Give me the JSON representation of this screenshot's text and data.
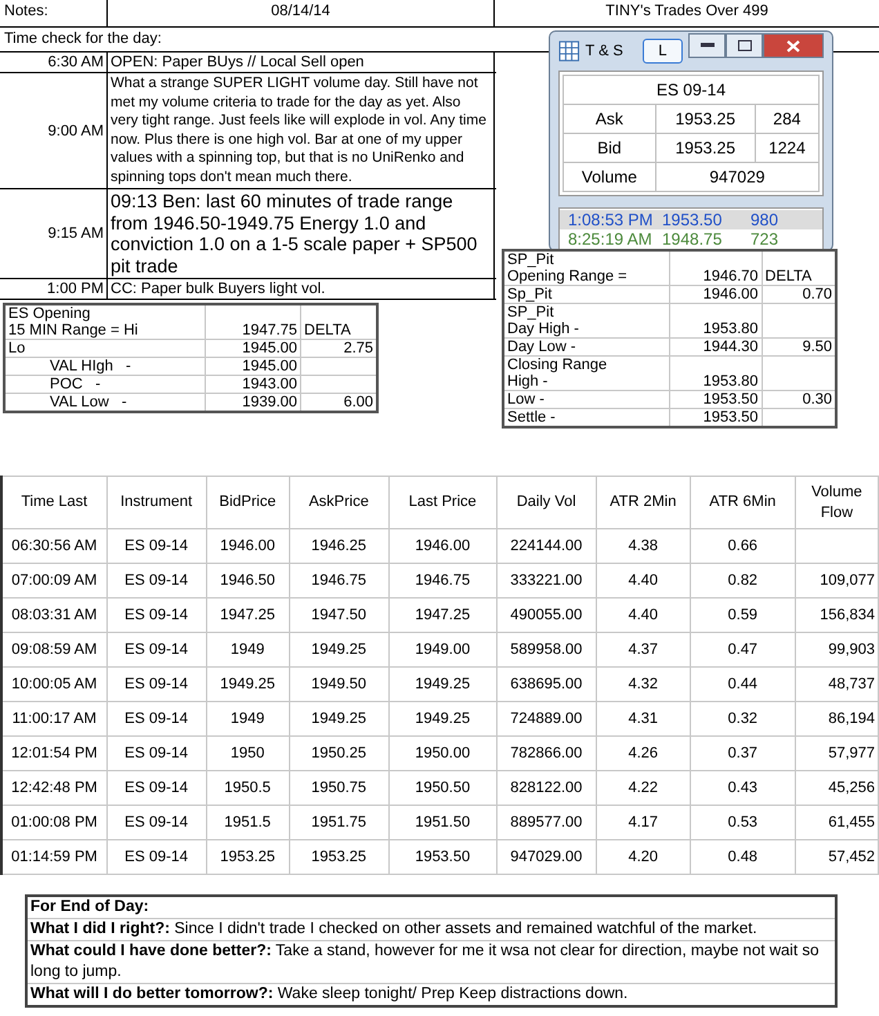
{
  "header": {
    "label": "Notes:",
    "date": "08/14/14",
    "title": "TINY's Trades Over 499"
  },
  "time_check": {
    "label": "Time check for the day:",
    "entries": [
      {
        "time": "6:30 AM",
        "note": "OPEN: Paper BUys // Local Sell open",
        "kind": "normal"
      },
      {
        "time": "9:00 AM",
        "note": "What a strange SUPER LIGHT volume day.  Still have not met my volume criteria to trade for the day as yet.  Also very tight range.  Just feels like will explode in vol. Any time now.  Plus there is one high vol. Bar at one of my upper values with a spinning top, but that is no UniRenko and spinning tops don't mean much there.",
        "kind": "small"
      },
      {
        "time": "9:15 AM",
        "note": "09:13 Ben: last 60 minutes of trade range from 1946.50-1949.75 Energy 1.0 and conviction 1.0 on a 1-5 scale paper + SP500 pit trade",
        "kind": "large"
      },
      {
        "time": "1:00 PM",
        "note": "CC: Paper bulk Buyers light vol.",
        "kind": "normal"
      }
    ]
  },
  "ts_window": {
    "title": "T & S",
    "link_button": "L",
    "symbol": "ES 09-14",
    "quotes": [
      {
        "label": "Ask",
        "price": "1953.25",
        "size": "284"
      },
      {
        "label": "Bid",
        "price": "1953.25",
        "size": "1224"
      }
    ],
    "volume": {
      "label": "Volume",
      "value": "947029"
    },
    "trades": [
      {
        "time": "1:08:53 PM",
        "price": "1953.50",
        "size": "980",
        "selected": true,
        "color": "#2050c8"
      },
      {
        "time": "8:25:19 AM",
        "price": "1948.75",
        "size": "723",
        "selected": false,
        "color": "#4c8a3c"
      }
    ]
  },
  "es_opening": {
    "rows": [
      {
        "label": [
          "ES Opening",
          "15 MIN Range = Hi"
        ],
        "value": "1947.75",
        "delta": "DELTA",
        "indented": false
      },
      {
        "label": [
          "Lo"
        ],
        "value": "1945.00",
        "delta": "2.75",
        "indented": false
      },
      {
        "label": [
          "VAL HIgh   -"
        ],
        "value": "1945.00",
        "delta": "",
        "indented": true
      },
      {
        "label": [
          "POC   -"
        ],
        "value": "1943.00",
        "delta": "",
        "indented": true
      },
      {
        "label": [
          "VAL Low   -"
        ],
        "value": "1939.00",
        "delta": "6.00",
        "indented": true
      }
    ]
  },
  "sp_pit": {
    "rows": [
      {
        "label": [
          "SP_Pit",
          "Opening Range ="
        ],
        "value": "1946.70",
        "delta": "DELTA",
        "indented": false
      },
      {
        "label": [
          "Sp_Pit"
        ],
        "value": "1946.00",
        "delta": "0.70",
        "indented": false
      },
      {
        "label": [
          "SP_Pit",
          "Day High -"
        ],
        "value": "1953.80",
        "delta": "",
        "indented": false
      },
      {
        "label": [
          "Day Low -"
        ],
        "value": "1944.30",
        "delta": "9.50",
        "indented": false
      },
      {
        "label": [
          "Closing Range",
          "High -"
        ],
        "value": "1953.80",
        "delta": "",
        "indented": false
      },
      {
        "label": [
          "Low -"
        ],
        "value": "1953.50",
        "delta": "0.30",
        "indented": false
      },
      {
        "label": [
          "Settle -"
        ],
        "value": "1953.50",
        "delta": "",
        "indented": false
      }
    ]
  },
  "table": {
    "columns": [
      "Time Last",
      "Instrument",
      "BidPrice",
      "AskPrice",
      "Last Price",
      "Daily Vol",
      "ATR 2Min",
      "ATR 6Min",
      "Volume Flow"
    ],
    "rows": [
      [
        "06:30:56 AM",
        "ES 09-14",
        "1946.00",
        "1946.25",
        "1946.00",
        "224144.00",
        "4.38",
        "0.66",
        ""
      ],
      [
        "07:00:09 AM",
        "ES 09-14",
        "1946.50",
        "1946.75",
        "1946.75",
        "333221.00",
        "4.40",
        "0.82",
        "109,077"
      ],
      [
        "08:03:31 AM",
        "ES 09-14",
        "1947.25",
        "1947.50",
        "1947.25",
        "490055.00",
        "4.40",
        "0.59",
        "156,834"
      ],
      [
        "09:08:59 AM",
        "ES 09-14",
        "1949",
        "1949.25",
        "1949.00",
        "589958.00",
        "4.37",
        "0.47",
        "99,903"
      ],
      [
        "10:00:05 AM",
        "ES 09-14",
        "1949.25",
        "1949.50",
        "1949.25",
        "638695.00",
        "4.32",
        "0.44",
        "48,737"
      ],
      [
        "11:00:17 AM",
        "ES 09-14",
        "1949",
        "1949.25",
        "1949.25",
        "724889.00",
        "4.31",
        "0.32",
        "86,194"
      ],
      [
        "12:01:54 PM",
        "ES 09-14",
        "1950",
        "1950.25",
        "1950.00",
        "782866.00",
        "4.26",
        "0.37",
        "57,977"
      ],
      [
        "12:42:48 PM",
        "ES 09-14",
        "1950.5",
        "1950.75",
        "1950.50",
        "828122.00",
        "4.22",
        "0.43",
        "45,256"
      ],
      [
        "01:00:08 PM",
        "ES 09-14",
        "1951.5",
        "1951.75",
        "1951.50",
        "889577.00",
        "4.17",
        "0.53",
        "61,455"
      ],
      [
        "01:14:59 PM",
        "ES 09-14",
        "1953.25",
        "1953.25",
        "1953.50",
        "947029.00",
        "4.20",
        "0.48",
        "57,452"
      ]
    ]
  },
  "end_of_day": {
    "title": "For End of Day:",
    "items": [
      {
        "question": "What I did I right?:",
        "answer": "Since I didn't trade I checked on other assets and remained watchful of the market."
      },
      {
        "question": "What could I have done better?:",
        "answer": "Take a stand, however for me it wsa not clear for direction, maybe not wait so long to jump."
      },
      {
        "question": "What will I do better tomorrow?:",
        "answer": "Wake sleep tonight/ Prep Keep distractions down."
      }
    ]
  }
}
